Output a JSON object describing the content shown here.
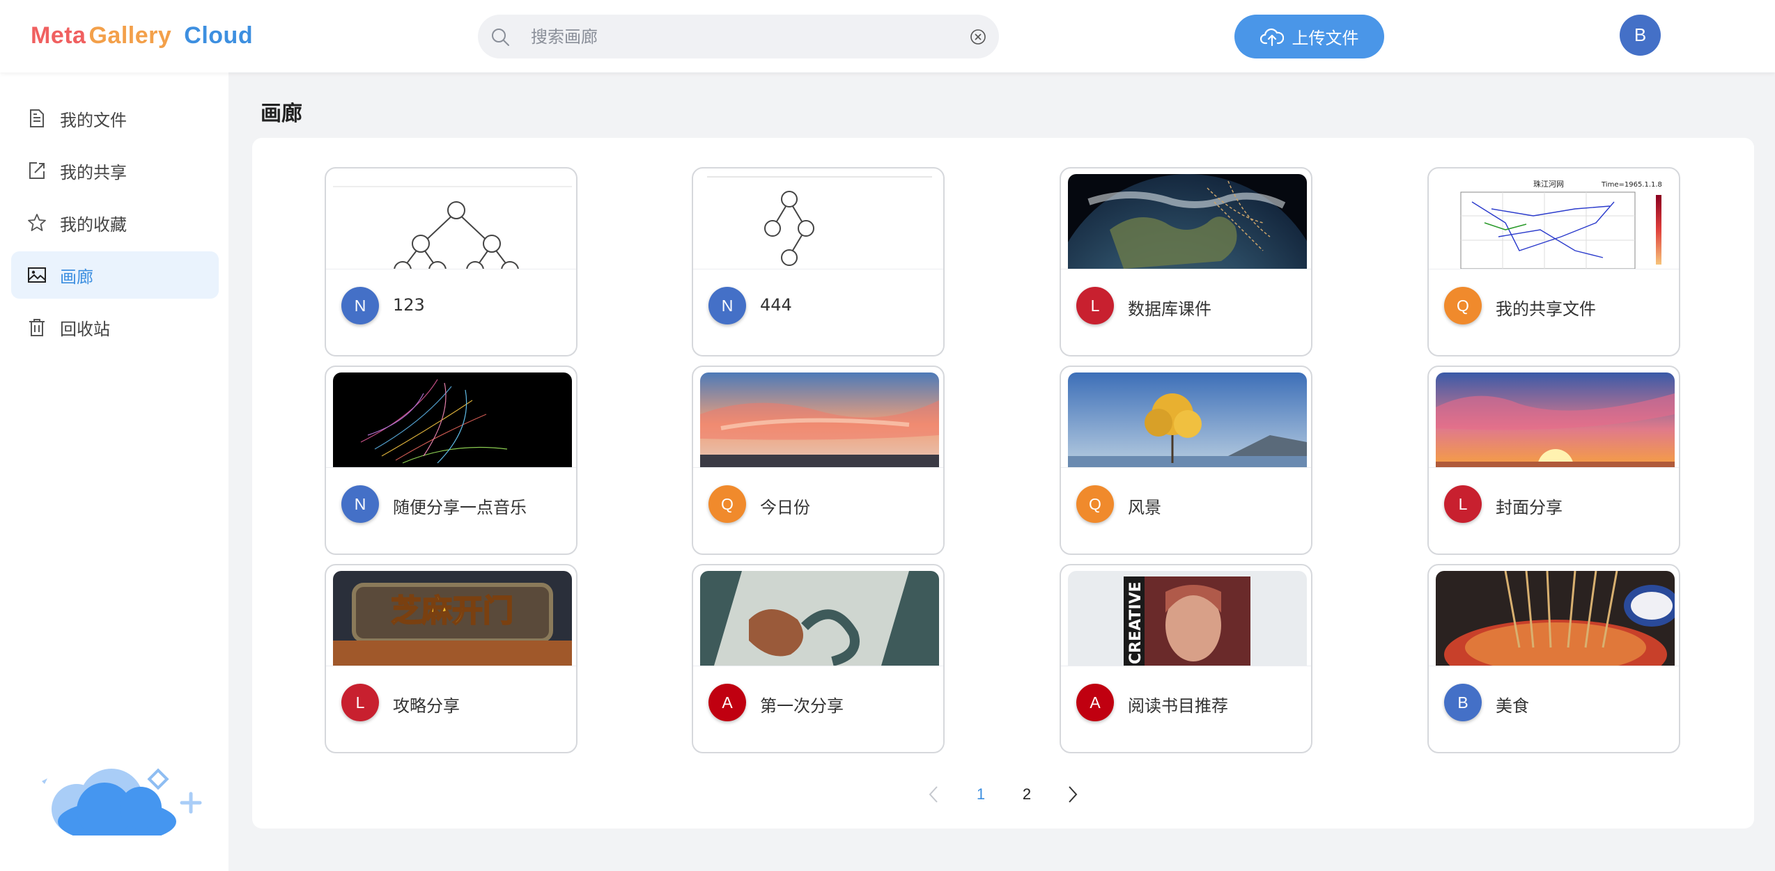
{
  "header": {
    "logo": {
      "part1": "Meta",
      "part2": "Gallery",
      "part3": "Cloud"
    },
    "search": {
      "placeholder": "搜索画廊",
      "value": ""
    },
    "upload_label": "上传文件",
    "user_initial": "B"
  },
  "sidebar": {
    "items": [
      {
        "label": "我的文件",
        "icon": "document-icon",
        "active": false
      },
      {
        "label": "我的共享",
        "icon": "share-icon",
        "active": false
      },
      {
        "label": "我的收藏",
        "icon": "star-icon",
        "active": false
      },
      {
        "label": "画廊",
        "icon": "image-icon",
        "active": true
      },
      {
        "label": "回收站",
        "icon": "trash-icon",
        "active": false
      }
    ]
  },
  "main": {
    "title": "画廊",
    "cards": [
      {
        "title": "123",
        "initial": "N",
        "avatar_color": "#4470c7",
        "thumb": "binary-tree-diagram"
      },
      {
        "title": "444",
        "initial": "N",
        "avatar_color": "#4470c7",
        "thumb": "tree-diagram"
      },
      {
        "title": "数据库课件",
        "initial": "L",
        "avatar_color": "#c8202f",
        "thumb": "earth-globe"
      },
      {
        "title": "我的共享文件",
        "initial": "Q",
        "avatar_color": "#f08a2c",
        "thumb": "river-network-chart"
      },
      {
        "title": "随便分享一点音乐",
        "initial": "N",
        "avatar_color": "#4470c7",
        "thumb": "particle-art"
      },
      {
        "title": "今日份",
        "initial": "Q",
        "avatar_color": "#f08a2c",
        "thumb": "sunset-clouds"
      },
      {
        "title": "风景",
        "initial": "Q",
        "avatar_color": "#f08a2c",
        "thumb": "lone-tree-lake"
      },
      {
        "title": "封面分享",
        "initial": "L",
        "avatar_color": "#c8202f",
        "thumb": "sunset-sky"
      },
      {
        "title": "攻略分享",
        "initial": "L",
        "avatar_color": "#c8202f",
        "thumb": "game-banner"
      },
      {
        "title": "第一次分享",
        "initial": "A",
        "avatar_color": "#c00010",
        "thumb": "book-cover"
      },
      {
        "title": "阅读书目推荐",
        "initial": "A",
        "avatar_color": "#c00010",
        "thumb": "magazine-cover"
      },
      {
        "title": "美食",
        "initial": "B",
        "avatar_color": "#4470c7",
        "thumb": "food-skewers"
      }
    ],
    "game_banner_text": "芝麻开门",
    "chart_thumb_title": "珠江河网",
    "chart_thumb_time": "Time=1965.1.1.8",
    "magazine_text": "CREATIVE"
  },
  "pagination": {
    "pages": [
      "1",
      "2"
    ],
    "current": "1"
  }
}
